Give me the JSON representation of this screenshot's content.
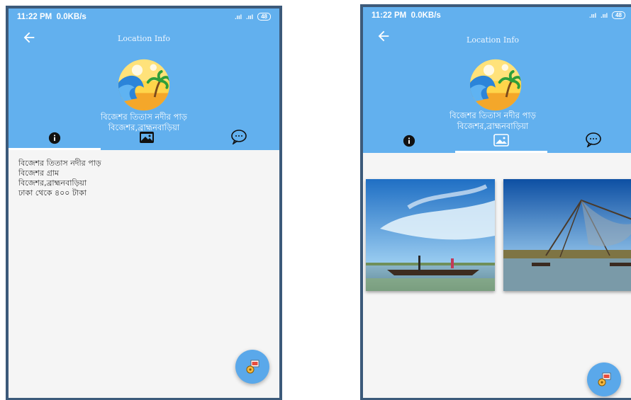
{
  "status": {
    "time": "11:22 PM",
    "speed": "0.0KB/s",
    "signal1": ".ııl",
    "signal2": ".ııl",
    "battery": "48"
  },
  "appbar": {
    "title": "Location Info"
  },
  "place": {
    "line1": "বিজেশর তিতাস নদীর পাড়",
    "line2": "বিজেশর,ব্রাহ্মনবাড়িয়া"
  },
  "tabs": [
    {
      "icon": "info-icon"
    },
    {
      "icon": "gallery-icon"
    },
    {
      "icon": "chat-icon"
    }
  ],
  "info": {
    "lines": [
      "বিজেশর তিতাস নদীর পাড়",
      "বিজেশর গ্রাম",
      "বিজেশর,ব্রাহ্মনবাড়িয়া",
      "ঢাকা থেকে ৪০০ টাকা"
    ]
  },
  "colors": {
    "appbar": "#62b0ee",
    "fab": "#5aa8ea",
    "frame": "#3c5a7a"
  }
}
